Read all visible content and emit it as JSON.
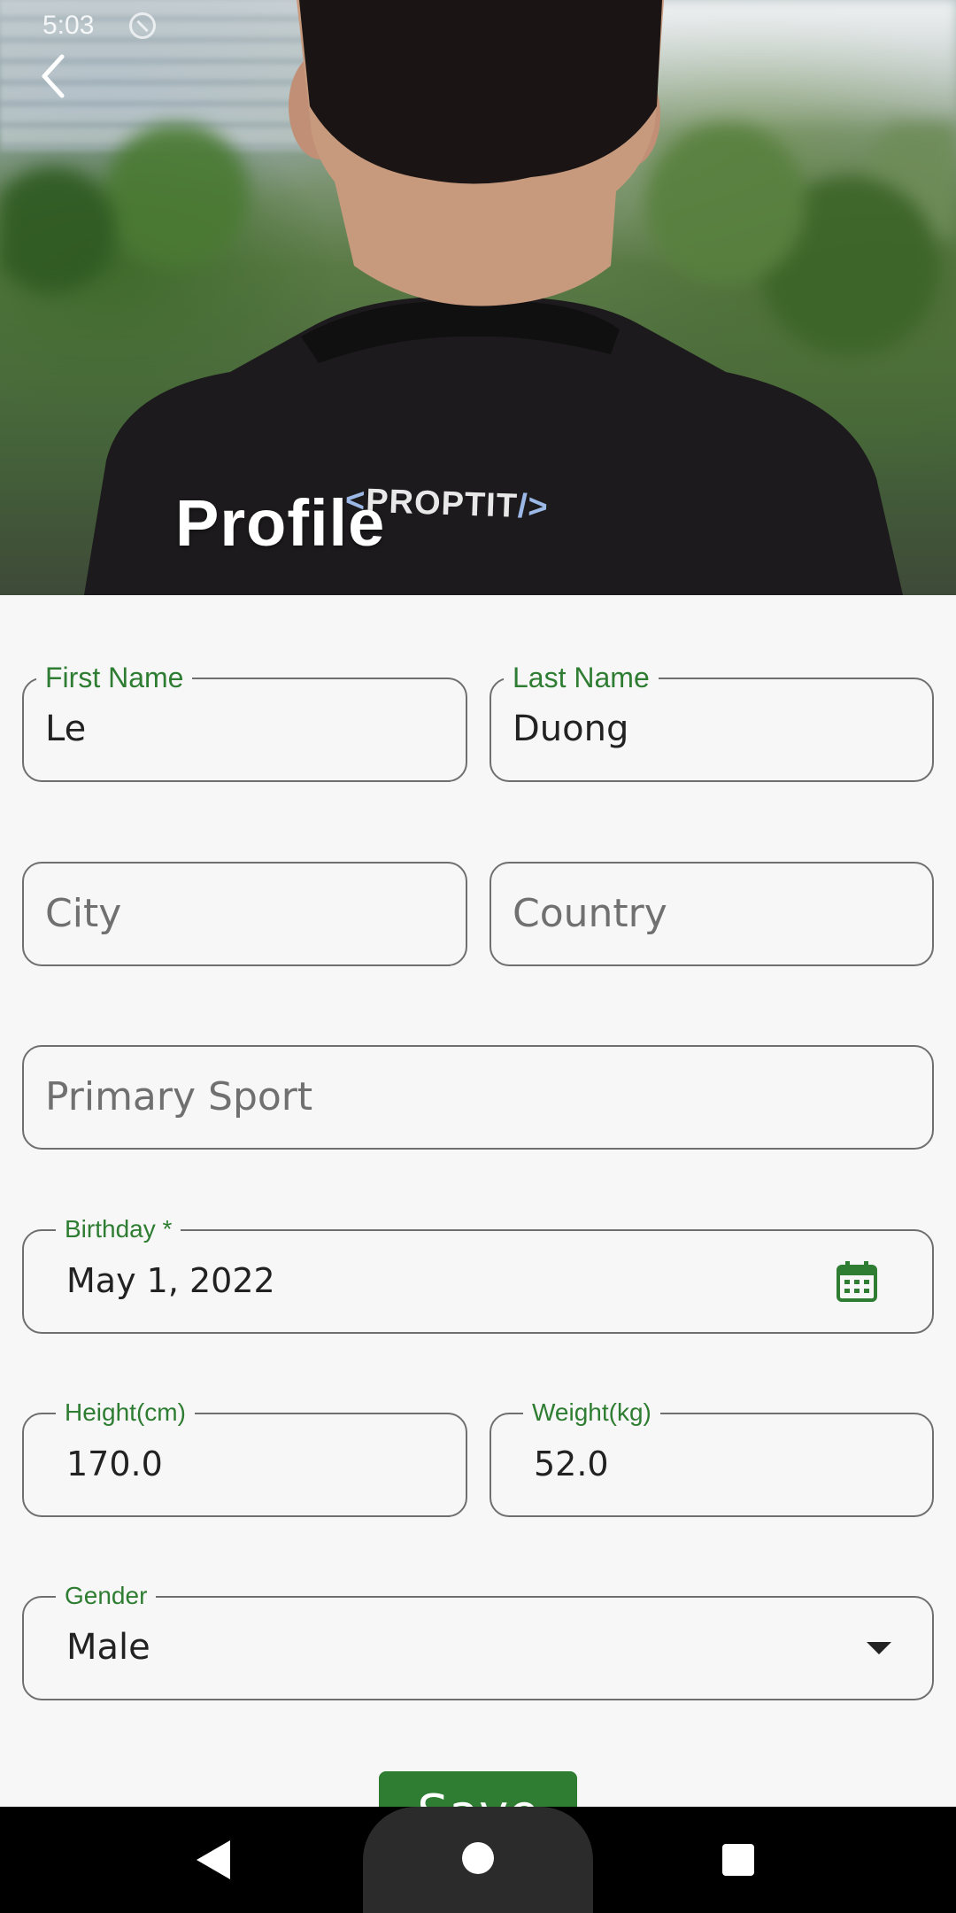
{
  "status_bar": {
    "time": "5:03"
  },
  "header": {
    "title": "Profile",
    "shirt_logo_text": "PROPTIT",
    "shirt_logo_open": "<",
    "shirt_logo_close": "/>"
  },
  "form": {
    "first_name": {
      "label": "First Name",
      "value": "Le"
    },
    "last_name": {
      "label": "Last Name",
      "value": "Duong"
    },
    "city": {
      "placeholder": "City"
    },
    "country": {
      "placeholder": "Country"
    },
    "primary_sport": {
      "placeholder": "Primary Sport"
    },
    "birthday": {
      "label": "Birthday *",
      "value": "May 1, 2022"
    },
    "height": {
      "label": "Height(cm)",
      "value": "170.0"
    },
    "weight": {
      "label": "Weight(kg)",
      "value": "52.0"
    },
    "gender": {
      "label": "Gender",
      "value": "Male"
    },
    "save_label": "Save"
  },
  "colors": {
    "accent": "#2e7d32",
    "border": "#6f6f6f",
    "background": "#f7f7f7"
  }
}
